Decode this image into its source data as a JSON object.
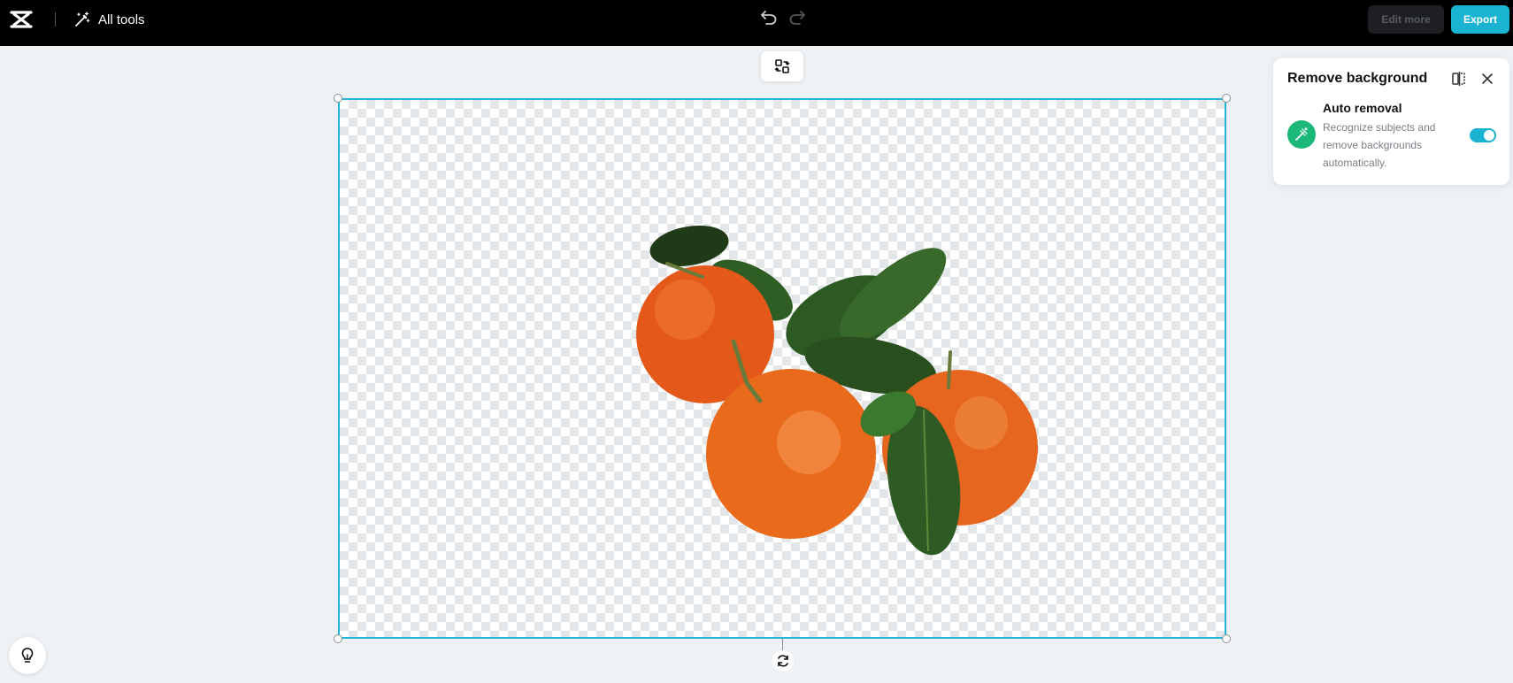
{
  "topbar": {
    "all_tools_label": "All tools",
    "edit_more_label": "Edit more",
    "export_label": "Export"
  },
  "panel": {
    "title": "Remove background",
    "auto_removal": {
      "title": "Auto removal",
      "description": "Recognize subjects and remove backgrounds automatically.",
      "enabled": true
    }
  },
  "colors": {
    "accent": "#1ab4d2",
    "auto_icon_bg": "#1bb87a",
    "topbar_bg": "#000000",
    "workspace_bg": "#eef2f5"
  },
  "icons": {
    "logo": "capcut-logo-icon",
    "all_tools": "magic-wand-icon",
    "undo": "undo-icon",
    "redo": "redo-icon",
    "swap": "swap-icon",
    "compare": "compare-icon",
    "close": "close-icon",
    "auto_removal": "auto-removal-icon",
    "rotate": "rotate-icon",
    "hint": "lightbulb-icon"
  }
}
